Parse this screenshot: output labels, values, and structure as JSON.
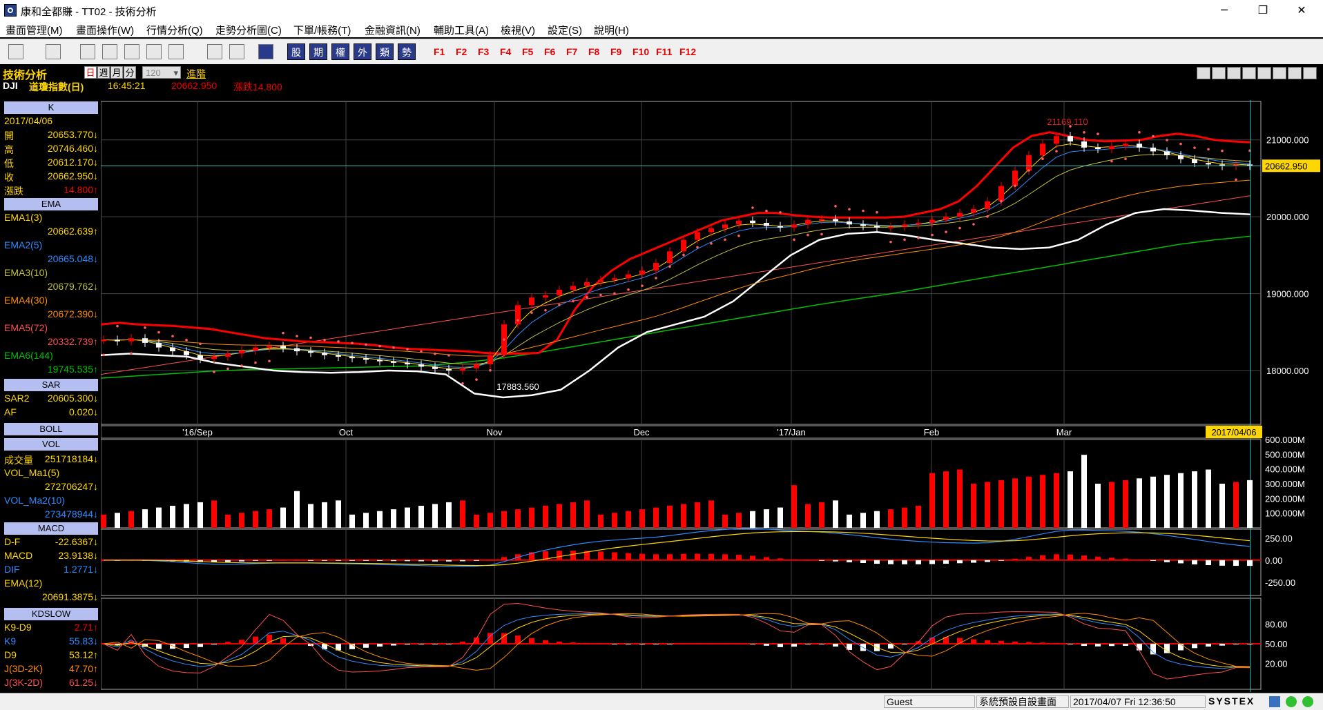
{
  "window": {
    "title": "康和全都賺 - TT02 - 技術分析"
  },
  "menu": [
    "畫面管理(M)",
    "畫面操作(W)",
    "行情分析(Q)",
    "走勢分析圖(C)",
    "下單/帳務(T)",
    "金融資訊(N)",
    "輔助工具(A)",
    "檢視(V)",
    "設定(S)",
    "說明(H)"
  ],
  "toolbar": {
    "shortcuts": [
      "股",
      "期",
      "權",
      "外",
      "類",
      "勢"
    ],
    "fkeys": [
      "F1",
      "F2",
      "F3",
      "F4",
      "F5",
      "F6",
      "F7",
      "F8",
      "F9",
      "F10",
      "F11",
      "F12"
    ]
  },
  "header": {
    "title": "技術分析",
    "tabs": [
      "日",
      "週",
      "月",
      "分"
    ],
    "period": "120",
    "advanced": "進階",
    "symbol": "DJI",
    "name": "道瓊指數(日)",
    "time": "16:45:21",
    "price": "20662.950",
    "change": "漲跌14.800"
  },
  "sidebar": {
    "k": {
      "header": "K",
      "date": "2017/04/06",
      "rows": [
        {
          "l": "開",
          "v": "20653.770↓"
        },
        {
          "l": "高",
          "v": "20746.460↓"
        },
        {
          "l": "低",
          "v": "20612.170↓"
        },
        {
          "l": "收",
          "v": "20662.950↓"
        },
        {
          "l": "漲跌",
          "v": "14.800↑"
        }
      ]
    },
    "ema": {
      "header": "EMA",
      "rows": [
        {
          "l": "EMA1(3)",
          "v": "20662.639↑"
        },
        {
          "l": "EMA2(5)",
          "v": "20665.048↓"
        },
        {
          "l": "EMA3(10)",
          "v": "20679.762↓"
        },
        {
          "l": "EMA4(30)",
          "v": "20672.390↓"
        },
        {
          "l": "EMA5(72)",
          "v": "20332.739↑"
        },
        {
          "l": "EMA6(144)",
          "v": "19745.535↑"
        }
      ]
    },
    "sar": {
      "header": "SAR",
      "rows": [
        {
          "l": "SAR2",
          "v": "20605.300↓"
        },
        {
          "l": "AF",
          "v": "0.020↓"
        }
      ]
    },
    "boll": {
      "header": "BOLL"
    },
    "vol": {
      "header": "VOL",
      "rows": [
        {
          "l": "成交量",
          "v": "251718184↓"
        },
        {
          "l": "VOL_Ma1(5)",
          "v": ""
        },
        {
          "l": "",
          "v": "272706247↓"
        },
        {
          "l": "VOL_Ma2(10)",
          "v": ""
        },
        {
          "l": "",
          "v": "273478944↓"
        }
      ]
    },
    "macd": {
      "header": "MACD",
      "rows": [
        {
          "l": "D-F",
          "v": "-22.6367↓"
        },
        {
          "l": "MACD",
          "v": "23.9138↓"
        },
        {
          "l": "DIF",
          "v": "1.2771↓"
        },
        {
          "l": "EMA(12)",
          "v": ""
        },
        {
          "l": "",
          "v": "20691.3875↓"
        }
      ]
    },
    "kd": {
      "header": "KDSLOW",
      "rows": [
        {
          "l": "K9-D9",
          "v": "2.71↑"
        },
        {
          "l": "K9",
          "v": "55.83↓"
        },
        {
          "l": "D9",
          "v": "53.12↑"
        },
        {
          "l": "J(3D-2K)",
          "v": "47.70↑"
        },
        {
          "l": "J(3K-2D)",
          "v": "61.25↓"
        }
      ]
    }
  },
  "chart_data": [
    {
      "type": "line",
      "name": "price",
      "x_labels": [
        "'16/Sep",
        "Oct",
        "Nov",
        "Dec",
        "'17/Jan",
        "Feb",
        "Mar"
      ],
      "y_ticks": [
        "21000.000",
        "20000.000",
        "19000.000",
        "18000.000"
      ],
      "ylim": [
        17300,
        21500
      ],
      "current": "20662.950",
      "current_date": "2017/04/06",
      "annotations": {
        "high": "21169.110",
        "low": "17883.560"
      },
      "close": [
        18400,
        18380,
        18420,
        18360,
        18300,
        18250,
        18200,
        18150,
        18180,
        18220,
        18260,
        18300,
        18320,
        18290,
        18250,
        18230,
        18200,
        18180,
        18160,
        18140,
        18120,
        18100,
        18080,
        18050,
        18020,
        18000,
        18030,
        18080,
        18200,
        18600,
        18850,
        18950,
        18980,
        19050,
        19100,
        19150,
        19180,
        19200,
        19250,
        19300,
        19400,
        19550,
        19700,
        19800,
        19850,
        19900,
        19950,
        19920,
        19880,
        19860,
        19900,
        19960,
        19970,
        19940,
        19900,
        19880,
        19860,
        19870,
        19900,
        19920,
        19960,
        20000,
        20050,
        20100,
        20200,
        20400,
        20600,
        20800,
        20950,
        21050,
        20980,
        20900,
        20880,
        20920,
        20950,
        20900,
        20850,
        20800,
        20750,
        20700,
        20680,
        20660,
        20680,
        20663
      ],
      "bb_upper": [
        18600,
        18620,
        18600,
        18590,
        18580,
        18560,
        18540,
        18500,
        18460,
        18420,
        18400,
        18380,
        18370,
        18360,
        18350,
        18330,
        18300,
        18280,
        18270,
        18260,
        18250,
        18230,
        18220,
        18220,
        18230,
        18400,
        18800,
        19100,
        19300,
        19450,
        19550,
        19650,
        19750,
        19850,
        19950,
        20000,
        20050,
        20050,
        20020,
        20000,
        19990,
        19990,
        19990,
        19990,
        20000,
        20050,
        20100,
        20200,
        20400,
        20650,
        20900,
        21050,
        21100,
        21050,
        21000,
        20980,
        20990,
        21000,
        21050,
        21080,
        21050,
        21000,
        20980,
        20970
      ],
      "ema6": [
        17900,
        17930,
        17960,
        17990,
        18010,
        18020,
        18030,
        18040,
        18050,
        18060,
        18100,
        18150,
        18220,
        18300,
        18380,
        18460,
        18540,
        18620,
        18700,
        18780,
        18860,
        18930,
        19000,
        19080,
        19160,
        19240,
        19320,
        19400,
        19480,
        19560,
        19640,
        19700,
        19746
      ],
      "boll_lower": [
        18200,
        18220,
        18200,
        18180,
        18100,
        18050,
        18000,
        17980,
        17970,
        17980,
        18000,
        17990,
        17950,
        17700,
        17650,
        17680,
        17750,
        18000,
        18300,
        18500,
        18600,
        18700,
        18900,
        19200,
        19500,
        19700,
        19780,
        19800,
        19760,
        19700,
        19650,
        19600,
        19580,
        19600,
        19700,
        19900,
        20050,
        20100,
        20080,
        20050,
        20030
      ]
    },
    {
      "type": "bar",
      "name": "VOL",
      "y_ticks": [
        "600.000M",
        "500.000M",
        "400.000M",
        "300.000M",
        "200.000M",
        "100.000M"
      ],
      "ylim": [
        0,
        600
      ]
    },
    {
      "type": "bar",
      "name": "MACD",
      "y_ticks": [
        "250.00",
        "0.00",
        "-250.00"
      ],
      "ylim": [
        -400,
        350
      ]
    },
    {
      "type": "line",
      "name": "KDSLOW",
      "y_ticks": [
        "80.00",
        "50.00",
        "20.00"
      ],
      "ylim": [
        -20,
        120
      ]
    }
  ],
  "statusbar": {
    "user": "Guest",
    "layout": "系統預設自設畫面",
    "datetime": "2017/04/07 Fri 12:36:50",
    "brand": "SYSTEX"
  },
  "colors": {
    "up": "#ff0000",
    "down": "#ffffff",
    "ema1": "#ffd700",
    "ema2": "#2e8bff",
    "ema3": "#c0c040",
    "ema4": "#ff8c00",
    "ema5": "#ff5050",
    "ema6": "#00c000",
    "boll": "#ff0000",
    "header_bg": "#b4bef0"
  }
}
